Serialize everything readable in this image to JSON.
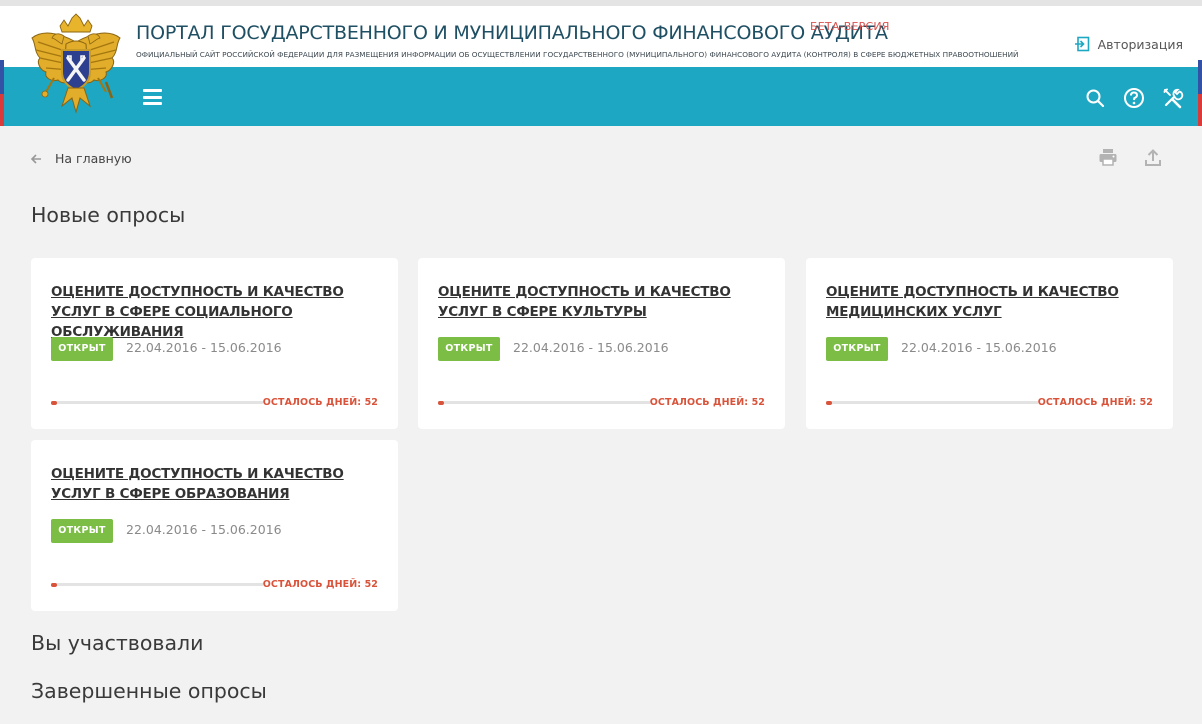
{
  "header": {
    "title": "ПОРТАЛ ГОСУДАРСТВЕННОГО И МУНИЦИПАЛЬНОГО ФИНАНСОВОГО АУДИТА",
    "beta": "БЕТА-ВЕРСИЯ",
    "subtitle": "ОФИЦИАЛЬНЫЙ САЙТ РОССИЙСКОЙ ФЕДЕРАЦИИ ДЛЯ РАЗМЕЩЕНИЯ ИНФОРМАЦИИ ОБ ОСУЩЕСТВЛЕНИИ ГОСУДАРСТВЕННОГО (МУНИЦИПАЛЬНОГО) ФИНАНСОВОГО АУДИТА (КОНТРОЛЯ) В СФЕРЕ БЮДЖЕТНЫХ ПРАВООТНОШЕНИЙ",
    "login_label": "Авторизация"
  },
  "colors": {
    "navbar": "#1ea7c2",
    "open_badge": "#7cbd45",
    "accent_red": "#d9533a"
  },
  "icons": {
    "emblem": "double-headed-eagle-emblem",
    "login": "login-icon",
    "menu": "hamburger-icon",
    "search": "search-icon",
    "help": "help-icon",
    "tools": "tools-icon",
    "back": "arrow-left-icon",
    "print": "print-icon",
    "share": "upload-icon"
  },
  "breadcrumb": {
    "back_label": "На главную"
  },
  "sections": {
    "new": "Новые опросы",
    "participated": "Вы участвовали",
    "finished": "Завершенные опросы"
  },
  "surveys": [
    {
      "title": "ОЦЕНИТЕ ДОСТУПНОСТЬ И КАЧЕСТВО УСЛУГ В СФЕРЕ СОЦИАЛЬНОГО ОБСЛУЖИВАНИЯ",
      "status": "ОТКРЫТ",
      "dates": "22.04.2016 - 15.06.2016",
      "days_left": "ОСТАЛОСЬ ДНЕЙ: 52",
      "progress_percent": 3
    },
    {
      "title": "ОЦЕНИТЕ ДОСТУПНОСТЬ И КАЧЕСТВО УСЛУГ В СФЕРЕ КУЛЬТУРЫ",
      "status": "ОТКРЫТ",
      "dates": "22.04.2016 - 15.06.2016",
      "days_left": "ОСТАЛОСЬ ДНЕЙ: 52",
      "progress_percent": 3
    },
    {
      "title": "ОЦЕНИТЕ ДОСТУПНОСТЬ И КАЧЕСТВО МЕДИЦИНСКИХ УСЛУГ",
      "status": "ОТКРЫТ",
      "dates": "22.04.2016 - 15.06.2016",
      "days_left": "ОСТАЛОСЬ ДНЕЙ: 52",
      "progress_percent": 3
    },
    {
      "title": "ОЦЕНИТЕ ДОСТУПНОСТЬ И КАЧЕСТВО УСЛУГ В СФЕРЕ ОБРАЗОВАНИЯ",
      "status": "ОТКРЫТ",
      "dates": "22.04.2016 - 15.06.2016",
      "days_left": "ОСТАЛОСЬ ДНЕЙ: 52",
      "progress_percent": 3
    }
  ]
}
